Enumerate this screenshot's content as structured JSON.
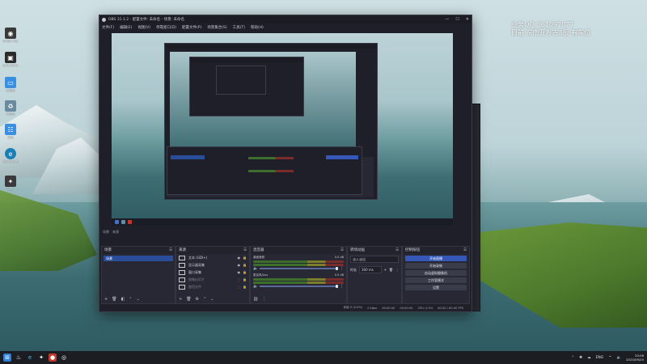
{
  "desktop": {
    "icons": [
      {
        "label": "NVIDIA App",
        "icon": "nvidia-icon",
        "color": "#3a3a3a"
      },
      {
        "label": "RemoteDesk",
        "icon": "app-icon",
        "color": "#2a2a2a"
      },
      {
        "label": "此电脑",
        "icon": "computer-icon",
        "color": "#3b8fe0"
      },
      {
        "label": "回收站",
        "icon": "recycle-bin-icon",
        "color": "#6a8aa0"
      },
      {
        "label": "网络",
        "icon": "network-icon",
        "color": "#3b8fe0"
      },
      {
        "label": "Microsoft Edge",
        "icon": "edge-icon",
        "color": "#1a7fb5"
      },
      {
        "label": "CS2",
        "icon": "game-icon",
        "color": "#3a3a3a"
      }
    ]
  },
  "overlay": {
    "line1": "业务QQ 361097077",
    "line2": "目前 东南亚万古3服 有车位"
  },
  "obs": {
    "title": "OBS 31.1.2 - 配置文件: 未命名 - 场景: 未命名",
    "menu": [
      "文件(F)",
      "编辑(E)",
      "视图(V)",
      "停靠窗口(D)",
      "配置文件(P)",
      "场景集合(S)",
      "工具(T)",
      "帮助(H)"
    ],
    "docks": {
      "scenes": {
        "title": "场景",
        "items": [
          {
            "label": "场景",
            "active": true
          }
        ]
      },
      "sources": {
        "title": "来源",
        "items": [
          {
            "label": "文本 (GDI+)",
            "dim": false
          },
          {
            "label": "显示器采集",
            "dim": false
          },
          {
            "label": "窗口采集",
            "dim": false
          },
          {
            "label": "图像幻灯片",
            "dim": true
          },
          {
            "label": "使用文件",
            "dim": true
          }
        ]
      },
      "mixer": {
        "title": "混音器",
        "channels": [
          {
            "name": "桌面音频",
            "db": "0.0 dB"
          },
          {
            "name": "麦克风/Aux",
            "db": "0.0 dB"
          }
        ]
      },
      "transitions": {
        "title": "转场动画",
        "type": "淡入淡出",
        "duration_label": "时长",
        "duration": "300 ms"
      },
      "controls": {
        "title": "控制按钮",
        "buttons": [
          "开始直播",
          "开始录制",
          "启动虚拟摄像机",
          "工作室模式",
          "设置"
        ]
      }
    },
    "status": {
      "frames": "丢帧 0 (0.0%)",
      "bitrate": "0 kbps",
      "time1": "00:00:00",
      "time2": "00:00:00",
      "cpu": "CPU: 0.5%",
      "fps": "60.00 / 60.00 FPS"
    },
    "header_labels": {
      "scene_label": "场景",
      "source_label": "来源"
    }
  },
  "taskbar": {
    "lang": "ENG",
    "time": "20:08",
    "date": "2025/09/20"
  }
}
